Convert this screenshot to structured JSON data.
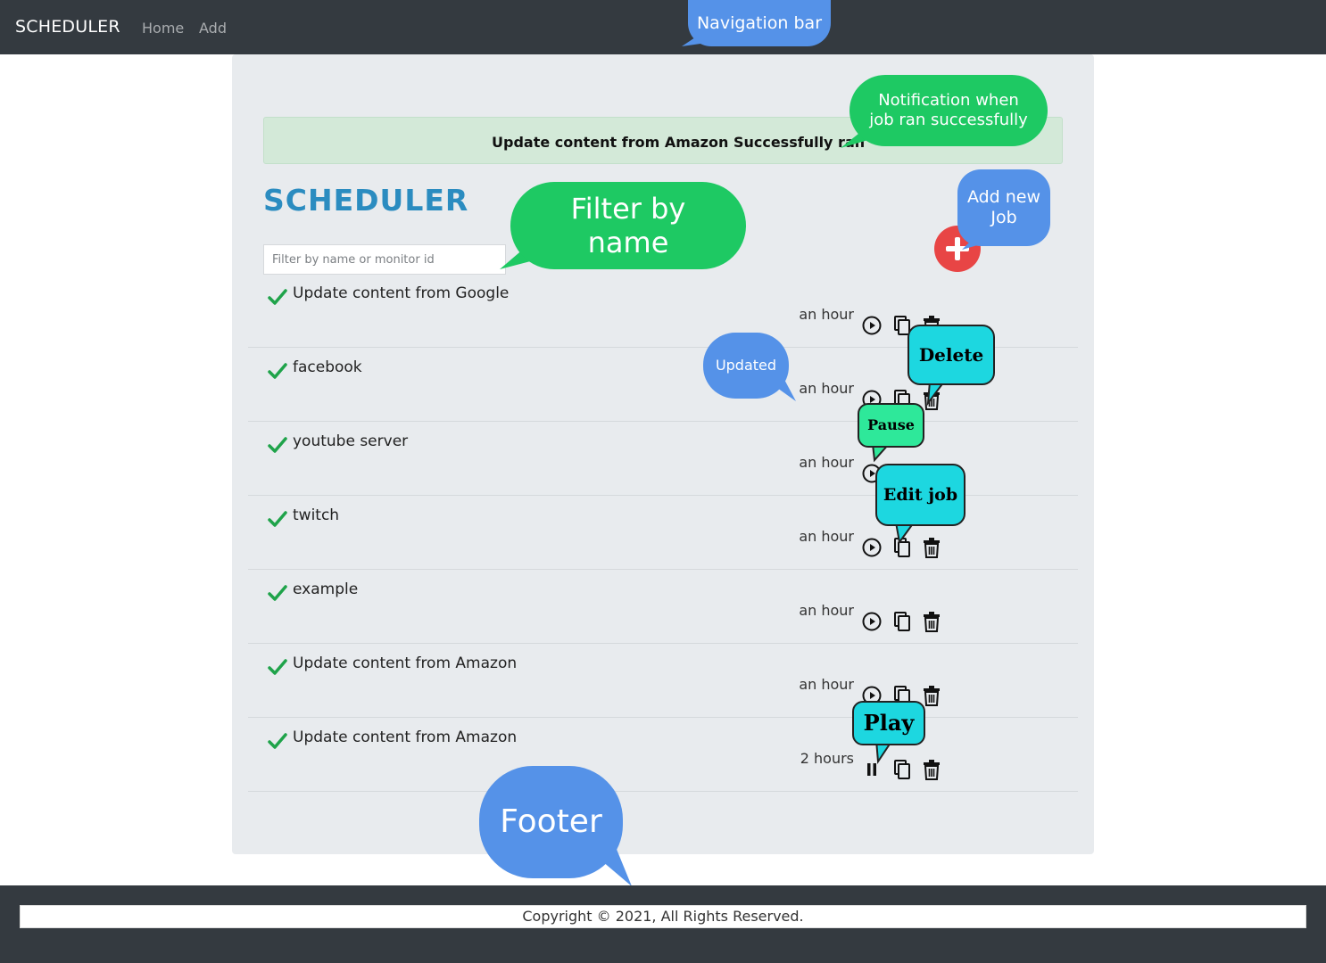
{
  "navbar": {
    "brand": "SCHEDULER",
    "links": [
      "Home",
      "Add"
    ]
  },
  "alert": {
    "text": "Update content from Amazon Successfully ran"
  },
  "page_title": "SCHEDULER",
  "filter": {
    "placeholder": "Filter by name or monitor id",
    "value": ""
  },
  "jobs": [
    {
      "name": "Update content from Google",
      "time": "an hour",
      "state_icon": "play-circle-icon"
    },
    {
      "name": "facebook",
      "time": "an hour",
      "state_icon": "play-circle-icon"
    },
    {
      "name": "youtube server",
      "time": "an hour",
      "state_icon": "play-circle-icon"
    },
    {
      "name": "twitch",
      "time": "an hour",
      "state_icon": "play-circle-icon"
    },
    {
      "name": "example",
      "time": "an hour",
      "state_icon": "play-circle-icon"
    },
    {
      "name": "Update content from Amazon",
      "time": "an hour",
      "state_icon": "play-circle-icon"
    },
    {
      "name": "Update content from Amazon",
      "time": "2 hours",
      "state_icon": "pause-icon"
    }
  ],
  "annotations": {
    "navigation_bar": "Navigation bar",
    "notification_line1": "Notification when",
    "notification_line2": "job ran successfully",
    "filter_line1": "Filter by",
    "filter_line2": "name",
    "add_line1": "Add new",
    "add_line2": "Job",
    "updated": "Updated",
    "delete": "Delete",
    "pause": "Pause",
    "edit": "Edit job",
    "play": "Play",
    "footer": "Footer"
  },
  "footer": {
    "text": "Copyright © 2021, All Rights Reserved."
  },
  "colors": {
    "navbar": "#343a40",
    "title": "#2b8cc0",
    "check": "#1fa34a",
    "add_button": "#e84545",
    "alert_bg": "#d3e9d8"
  }
}
